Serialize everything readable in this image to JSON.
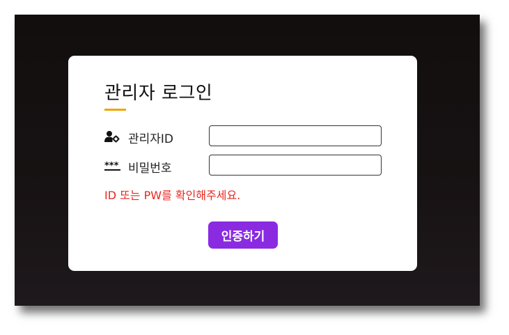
{
  "login": {
    "title": "관리자 로그인",
    "id_label": "관리자ID",
    "id_icon": "user-gear-icon",
    "id_value": "",
    "id_placeholder": "",
    "pw_label": "비밀번호",
    "pw_icon": "password-dots-icon",
    "pw_value": "",
    "pw_placeholder": "",
    "error_message": "ID 또는 PW를 확인해주세요.",
    "submit_label": "인증하기"
  },
  "colors": {
    "accent_underline": "#f0a500",
    "button": "#8a2be2",
    "error": "#e8271f",
    "backdrop": "#141011"
  }
}
